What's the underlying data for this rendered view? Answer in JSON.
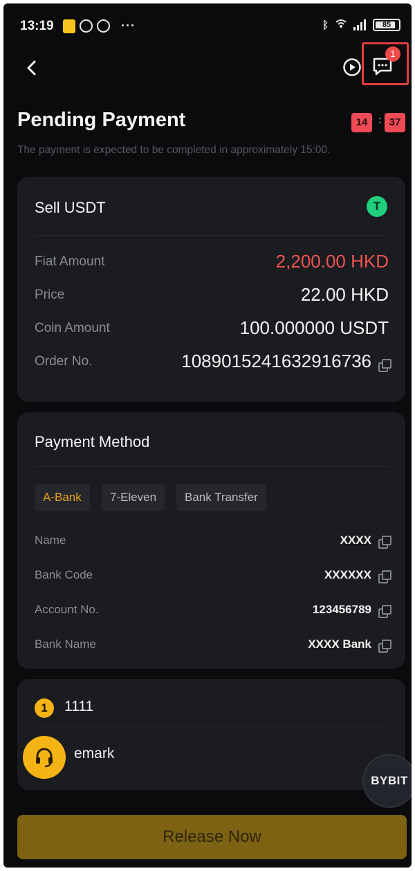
{
  "status_bar": {
    "time": "13:19",
    "battery": "85"
  },
  "nav": {
    "chat_badge": "1"
  },
  "header": {
    "title": "Pending Payment",
    "timer_minutes": "14",
    "timer_seconds": "37",
    "timer_separator": ":",
    "subtitle": "The payment is expected to be completed in approximately 15:00."
  },
  "order": {
    "title": "Sell USDT",
    "coin_icon": "T",
    "rows": [
      {
        "label": "Fiat Amount",
        "value": "2,200.00 HKD"
      },
      {
        "label": "Price",
        "value": "22.00 HKD"
      },
      {
        "label": "Coin Amount",
        "value": "100.000000 USDT"
      },
      {
        "label": "Order No.",
        "value": "1089015241632916736"
      }
    ]
  },
  "payment_method": {
    "title": "Payment Method",
    "tabs": [
      "A-Bank",
      "7-Eleven",
      "Bank Transfer"
    ],
    "selected_tab": "A-Bank",
    "fields": [
      {
        "label": "Name",
        "value": "XXXX"
      },
      {
        "label": "Bank Code",
        "value": "XXXXXX"
      },
      {
        "label": "Account No.",
        "value": "123456789"
      },
      {
        "label": "Bank Name",
        "value": "XXXX Bank"
      }
    ]
  },
  "notes": {
    "step_number": "1",
    "step_text": "1111",
    "remark": "emark"
  },
  "floating": {
    "bybit_logo": "BYBIT"
  },
  "action": {
    "release_label": "Release Now"
  },
  "colors": {
    "accent_gold": "#f4b416",
    "fiat_red": "#ef5353",
    "tether_green": "#1fcf7b",
    "highlight_box": "#e43d3d"
  }
}
